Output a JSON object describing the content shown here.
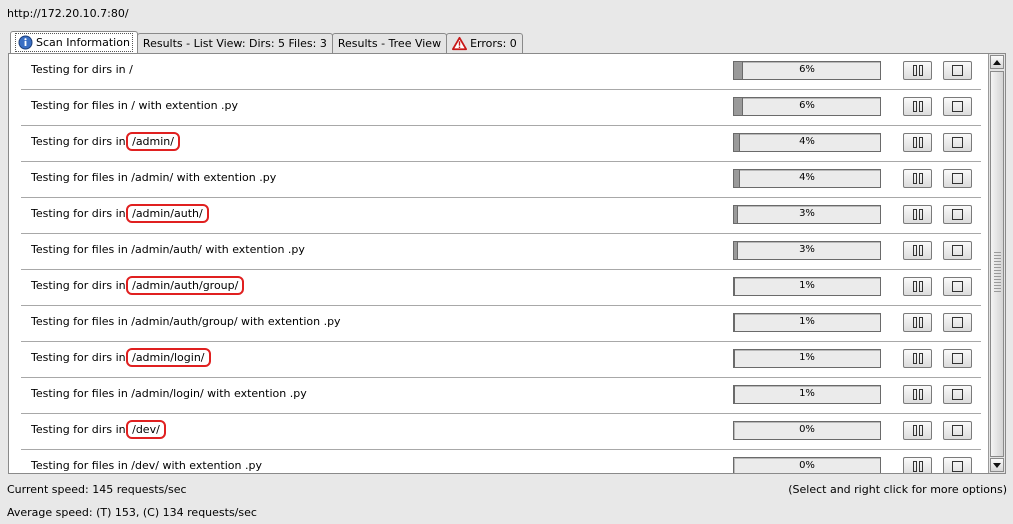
{
  "url": "http://172.20.10.7:80/",
  "tabs": [
    {
      "label": "Scan Information",
      "icon": "info-icon"
    },
    {
      "label": "Results - List View: Dirs: 5 Files: 3",
      "icon": ""
    },
    {
      "label": "Results - Tree View",
      "icon": ""
    },
    {
      "label": "Errors: 0",
      "icon": "warning-icon"
    }
  ],
  "rows": [
    {
      "prefix": "Testing for dirs in ",
      "path": "/",
      "suffix": "",
      "highlight": false,
      "percent": "6%",
      "progress": 0.06
    },
    {
      "prefix": "Testing for files in ",
      "path": "/",
      "suffix": " with extention .py",
      "highlight": false,
      "percent": "6%",
      "progress": 0.06
    },
    {
      "prefix": "Testing for dirs in ",
      "path": "/admin/",
      "suffix": "",
      "highlight": true,
      "percent": "4%",
      "progress": 0.04
    },
    {
      "prefix": "Testing for files in ",
      "path": "/admin/",
      "suffix": " with extention .py",
      "highlight": false,
      "percent": "4%",
      "progress": 0.04
    },
    {
      "prefix": "Testing for dirs in ",
      "path": "/admin/auth/",
      "suffix": "",
      "highlight": true,
      "percent": "3%",
      "progress": 0.03
    },
    {
      "prefix": "Testing for files in ",
      "path": "/admin/auth/",
      "suffix": " with extention .py",
      "highlight": false,
      "percent": "3%",
      "progress": 0.03
    },
    {
      "prefix": "Testing for dirs in ",
      "path": "/admin/auth/group/",
      "suffix": "",
      "highlight": true,
      "percent": "1%",
      "progress": 0.01
    },
    {
      "prefix": "Testing for files in ",
      "path": "/admin/auth/group/",
      "suffix": " with extention .py",
      "highlight": false,
      "percent": "1%",
      "progress": 0.01
    },
    {
      "prefix": "Testing for dirs in ",
      "path": "/admin/login/",
      "suffix": "",
      "highlight": true,
      "percent": "1%",
      "progress": 0.01
    },
    {
      "prefix": "Testing for files in ",
      "path": "/admin/login/",
      "suffix": " with extention .py",
      "highlight": false,
      "percent": "1%",
      "progress": 0.01
    },
    {
      "prefix": "Testing for dirs in ",
      "path": "/dev/",
      "suffix": "",
      "highlight": true,
      "percent": "0%",
      "progress": 0.0
    },
    {
      "prefix": "Testing for files in ",
      "path": "/dev/",
      "suffix": " with extention .py",
      "highlight": false,
      "percent": "0%",
      "progress": 0.0
    }
  ],
  "status": {
    "current_speed": "Current speed: 145 requests/sec",
    "average_speed": "Average speed: (T) 153, (C) 134 requests/sec",
    "hint": "(Select and right click for more options)"
  },
  "colors": {
    "highlight": "#e02020",
    "info_icon": "#3a6fc4",
    "warning_icon": "#c81818",
    "progress_fill": "#9a9a9a"
  }
}
